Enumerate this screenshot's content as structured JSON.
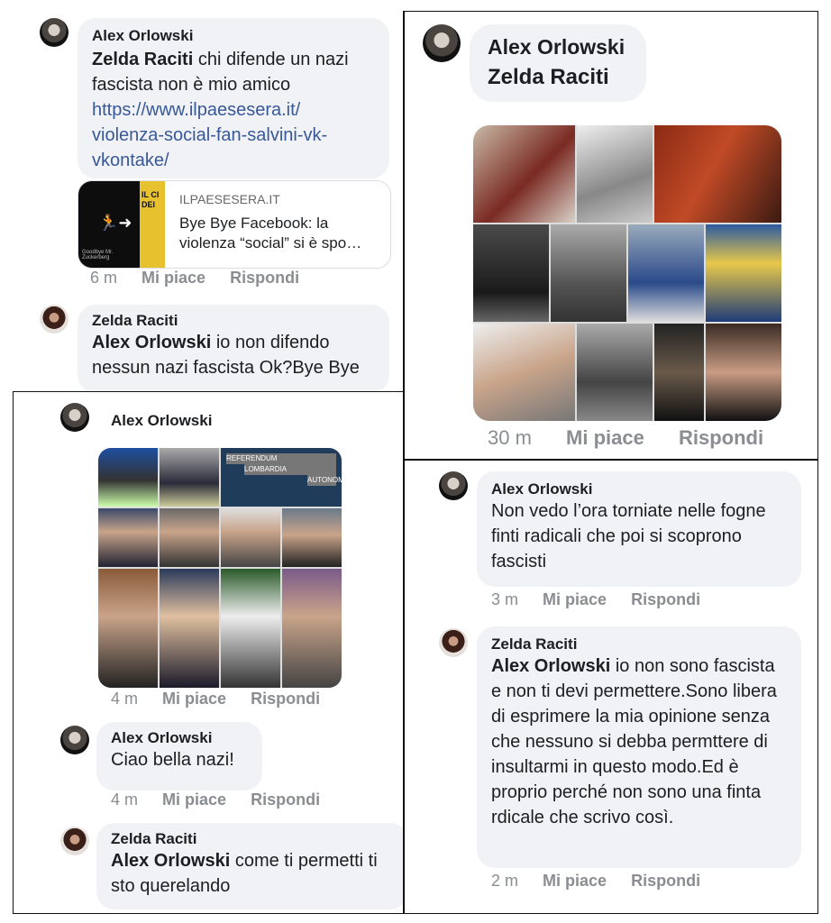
{
  "panel1": {
    "c1": {
      "author": "Alex Orlowski",
      "tag": "Zelda Raciti",
      "text": " chi difende un nazi fascista non è mio amico",
      "link": "https://www.ilpaesesera.it/ violenza-social-fan-salvini-vk- vkontake/"
    },
    "preview": {
      "site": "ILPAESESERA.IT",
      "title": "Bye Bye Facebook: la violenza “social” si è spo…",
      "thumb_text": "IL CI DEI",
      "thumb_small": "Goodbye Mr. Zuckerberg"
    },
    "meta1": {
      "time": "6 m",
      "like": "Mi piace",
      "reply": "Rispondi"
    },
    "c2": {
      "author": "Zelda Raciti",
      "tag": "Alex Orlowski",
      "text": " io non difendo nessun nazi fascista Ok?Bye Bye"
    }
  },
  "panel2": {
    "c1": {
      "author": "Alex Orlowski",
      "tag": "Zelda Raciti"
    },
    "meta": {
      "time": "30 m",
      "like": "Mi piace",
      "reply": "Rispondi"
    }
  },
  "panel3": {
    "c1": {
      "author": "Alex Orlowski",
      "banner1": "REFERENDUM",
      "banner2": "LOMBARDIA",
      "banner3": "AUTONOMIA"
    },
    "meta1": {
      "time": "4 m",
      "like": "Mi piace",
      "reply": "Rispondi"
    },
    "c2": {
      "author": "Alex Orlowski",
      "text": "Ciao bella nazi!"
    },
    "meta2": {
      "time": "4 m",
      "like": "Mi piace",
      "reply": "Rispondi"
    },
    "c3": {
      "author": "Zelda Raciti",
      "tag": "Alex Orlowski",
      "text": " come ti permetti ti sto querelando"
    }
  },
  "panel4": {
    "c1": {
      "author": "Alex Orlowski",
      "text": "Non vedo l’ora torniate nelle fogne finti radicali che poi si scoprono fascisti"
    },
    "meta1": {
      "time": "3 m",
      "like": "Mi piace",
      "reply": "Rispondi"
    },
    "c2": {
      "author": "Zelda Raciti",
      "tag": "Alex Orlowski",
      "text": " io non sono fascista e non ti devi permettere.Sono libera di esprimere la mia opinione senza che nessuno si debba permttere di insultarmi in questo modo.Ed è proprio perché non sono una finta rdicale che scrivo così."
    },
    "meta2": {
      "time": "2 m",
      "like": "Mi piace",
      "reply": "Rispondi"
    }
  },
  "colors": {
    "bubble": "#f0f2f5",
    "link": "#385898",
    "meta": "#8a8d91",
    "border": "#111111"
  },
  "icons": {
    "avatar_alex": "avatar-photo",
    "avatar_zelda": "avatar-photo",
    "exit_icon": "running-exit-icon"
  }
}
